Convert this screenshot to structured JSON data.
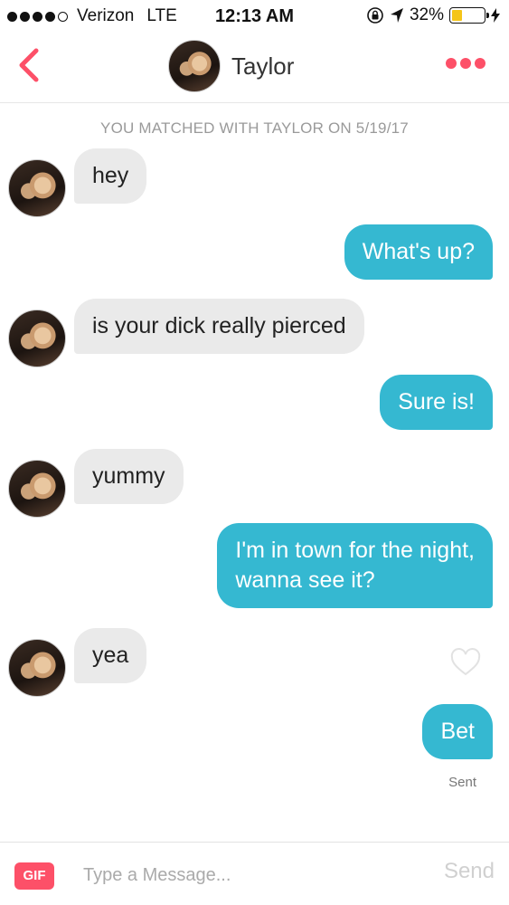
{
  "status_bar": {
    "carrier": "Verizon",
    "network": "LTE",
    "time": "12:13 AM",
    "battery_percent": "32%",
    "battery_level": 0.32,
    "battery_color": "#f5c518",
    "icons": [
      "signal-dots-icon",
      "rotation-lock-icon",
      "location-arrow-icon",
      "battery-icon",
      "charging-bolt-icon"
    ]
  },
  "nav": {
    "back_icon": "chevron-left-icon",
    "title": "Taylor",
    "more_icon": "more-dots-icon",
    "accent_color": "#fd5068"
  },
  "chat": {
    "match_note": "YOU MATCHED WITH TAYLOR ON 5/19/17",
    "messages": [
      {
        "from": "them",
        "text": "hey"
      },
      {
        "from": "me",
        "text": "What's up?"
      },
      {
        "from": "them",
        "text": "is your dick really pierced"
      },
      {
        "from": "me",
        "text": "Sure is!"
      },
      {
        "from": "them",
        "text": "yummy"
      },
      {
        "from": "me",
        "line1": "I'm in town for the night,",
        "line2": "wanna see it?"
      },
      {
        "from": "them",
        "text": "yea"
      },
      {
        "from": "me",
        "text": "Bet"
      }
    ],
    "sent_status": "Sent",
    "outgoing_color": "#35b8d1",
    "incoming_color": "#eaeaea"
  },
  "composer": {
    "gif_label": "GIF",
    "placeholder": "Type a Message...",
    "value": "",
    "send_label": "Send"
  }
}
